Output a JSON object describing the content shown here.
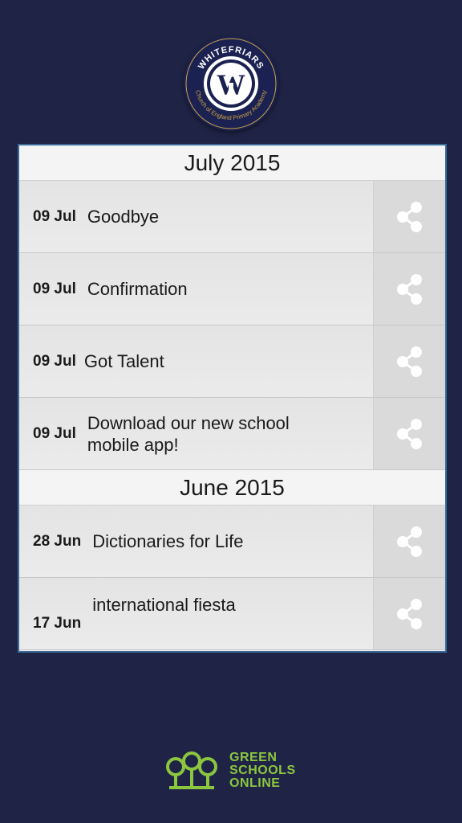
{
  "logo": {
    "top_text": "WHITEFRIARS",
    "ring_text": "Church of England Primary Academy",
    "monogram": "W"
  },
  "sections": [
    {
      "month": "July 2015",
      "items": [
        {
          "date": "09 Jul",
          "title": "Goodbye"
        },
        {
          "date": "09 Jul",
          "title": "Confirmation"
        },
        {
          "date": "09 Jul",
          "title": "Got Talent"
        },
        {
          "date": "09 Jul",
          "title": "Download our new school mobile app!"
        }
      ]
    },
    {
      "month": "June 2015",
      "items": [
        {
          "date": "28 Jun",
          "title": "Dictionaries for Life"
        },
        {
          "date": "17 Jun",
          "title": "international fiesta"
        }
      ]
    }
  ],
  "footer": {
    "line1": "GREEN",
    "line2": "SCHOOLS",
    "line3": "ONLINE"
  },
  "icons": {
    "share": "share-icon",
    "brand": "green-schools-online-logo"
  },
  "colors": {
    "background": "#1f2446",
    "panel_border": "#3a6b9a",
    "brand_green": "#8cc63f"
  }
}
